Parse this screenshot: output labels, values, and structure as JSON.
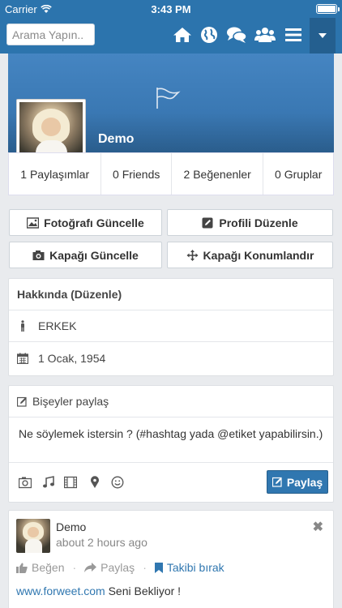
{
  "status": {
    "carrier": "Carrier",
    "time": "3:43 PM"
  },
  "nav": {
    "search_placeholder": "Arama Yapın..",
    "icons": [
      "home-icon",
      "globe-icon",
      "chat-icon",
      "users-icon",
      "menu-icon",
      "caret-down-icon"
    ]
  },
  "profile": {
    "name": "Demo"
  },
  "stats": [
    {
      "label": "1 Paylaşımlar"
    },
    {
      "label": "0 Friends"
    },
    {
      "label": "2 Beğenenler"
    },
    {
      "label": "0 Gruplar"
    }
  ],
  "buttons": {
    "update_photo": "Fotoğrafı Güncelle",
    "edit_profile": "Profili Düzenle",
    "update_cover": "Kapağı Güncelle",
    "position_cover": "Kapağı Konumlandır"
  },
  "about": {
    "title": "Hakkında (Düzenle)",
    "gender": "ERKEK",
    "birthday": "1 Ocak, 1954"
  },
  "share": {
    "title": "Bişeyler paylaş",
    "placeholder": "Ne söylemek istersin ? (#hashtag yada @etiket yapabilirsin.)",
    "button": "Paylaş"
  },
  "post": {
    "author": "Demo",
    "time": "about 2 hours ago",
    "like": "Beğen",
    "share": "Paylaş",
    "unfollow": "Takibi bırak",
    "link": "www.forweet.com",
    "text": " Seni Bekliyor !",
    "sep": "·"
  },
  "colors": {
    "primary": "#2c74ad",
    "link": "#3077b0",
    "background": "#e9ebee"
  }
}
